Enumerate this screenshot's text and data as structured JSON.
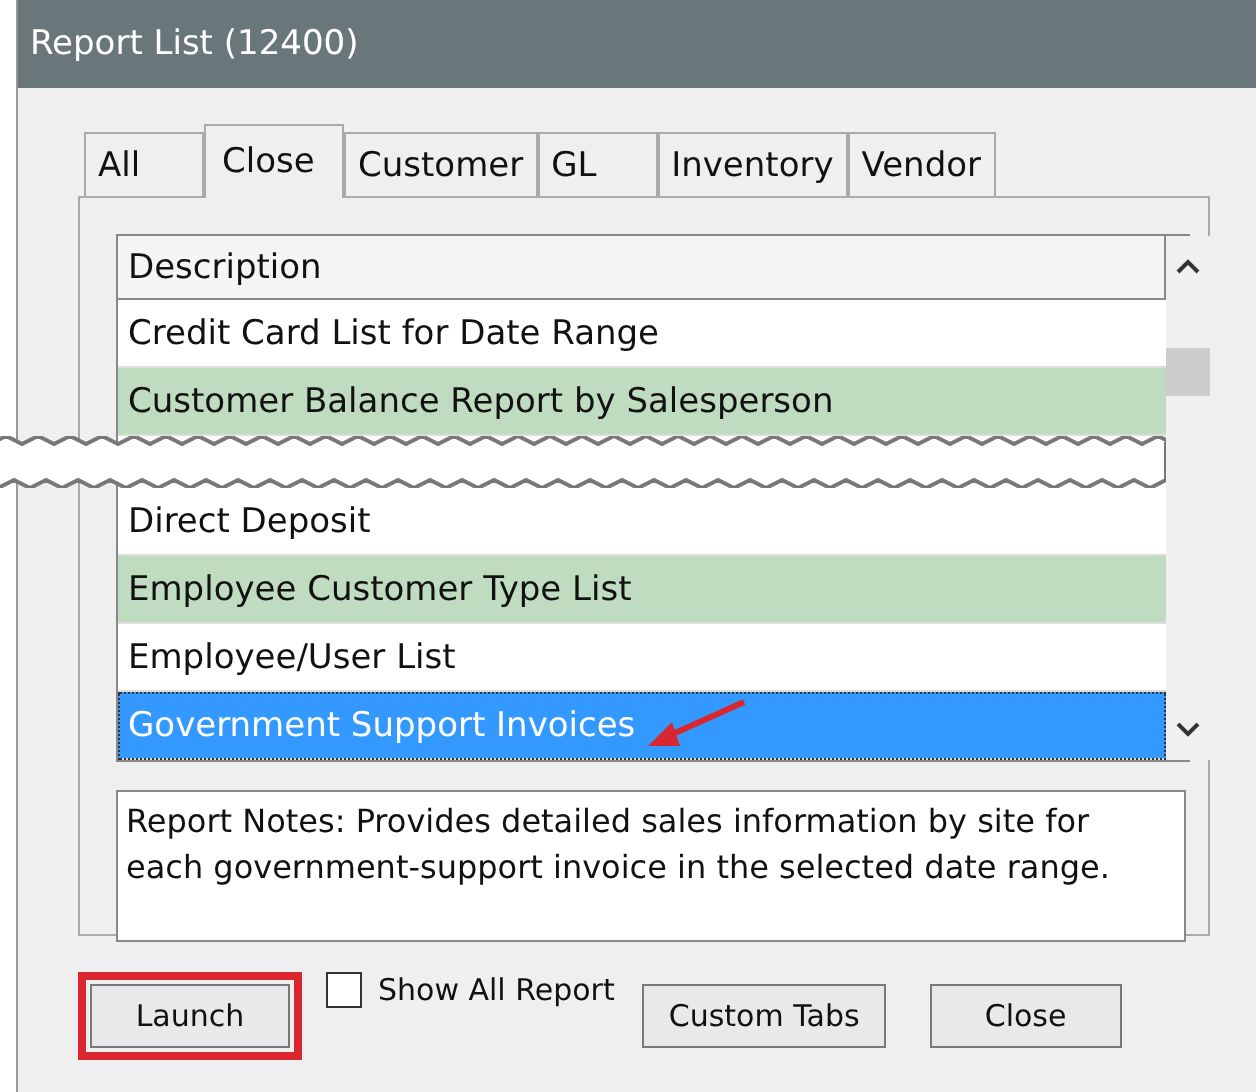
{
  "window": {
    "title": "Report List (12400)"
  },
  "tabs": [
    {
      "label": "All",
      "selected": false
    },
    {
      "label": "Close",
      "selected": true
    },
    {
      "label": "Customer",
      "selected": false
    },
    {
      "label": "GL",
      "selected": false
    },
    {
      "label": "Inventory",
      "selected": false
    },
    {
      "label": "Vendor",
      "selected": false
    }
  ],
  "list": {
    "header": "Description",
    "rows_before_break": [
      {
        "text": "Credit Card List for Date Range",
        "shaded": false,
        "selected": false
      },
      {
        "text": "Customer Balance Report by Salesperson",
        "shaded": true,
        "selected": false
      }
    ],
    "rows_after_break": [
      {
        "text": "Direct Deposit",
        "shaded": false,
        "selected": false
      },
      {
        "text": "Employee Customer Type List",
        "shaded": true,
        "selected": false
      },
      {
        "text": "Employee/User List",
        "shaded": false,
        "selected": false
      },
      {
        "text": "Government Support Invoices",
        "shaded": false,
        "selected": true,
        "arrow": true
      }
    ]
  },
  "notes": "Report Notes:  Provides detailed sales information by site for each government-support invoice in the selected date range.",
  "launch": {
    "label": "Launch",
    "highlighted": true
  },
  "show_all": {
    "label": "Show All Report",
    "checked": false
  },
  "buttons": [
    "Custom Tabs",
    "Close"
  ]
}
